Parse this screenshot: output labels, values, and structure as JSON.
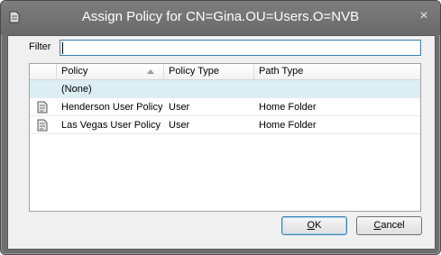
{
  "window": {
    "title": "Assign Policy for CN=Gina.OU=Users.O=NVB",
    "close_glyph": "×"
  },
  "filter": {
    "label": "Filter",
    "value": ""
  },
  "table": {
    "columns": [
      {
        "label": "Policy",
        "sorted": "ascending"
      },
      {
        "label": "Policy Type"
      },
      {
        "label": "Path Type"
      }
    ],
    "rows": [
      {
        "icon": "none",
        "policy": "(None)",
        "policy_type": "",
        "path_type": "",
        "selected": true
      },
      {
        "icon": "policy-document-icon",
        "policy": "Henderson User Policy",
        "policy_type": "User",
        "path_type": "Home Folder"
      },
      {
        "icon": "policy-document-icon",
        "policy": "Las Vegas User Policy",
        "policy_type": "User",
        "path_type": "Home Folder"
      }
    ]
  },
  "buttons": {
    "ok_mnemonic": "O",
    "ok_rest": "K",
    "cancel_mnemonic": "C",
    "cancel_rest": "ancel"
  },
  "colors": {
    "titlebar": "#6e6e6e",
    "selected_row": "#dcedf4",
    "focus_border": "#3c7fb1"
  }
}
